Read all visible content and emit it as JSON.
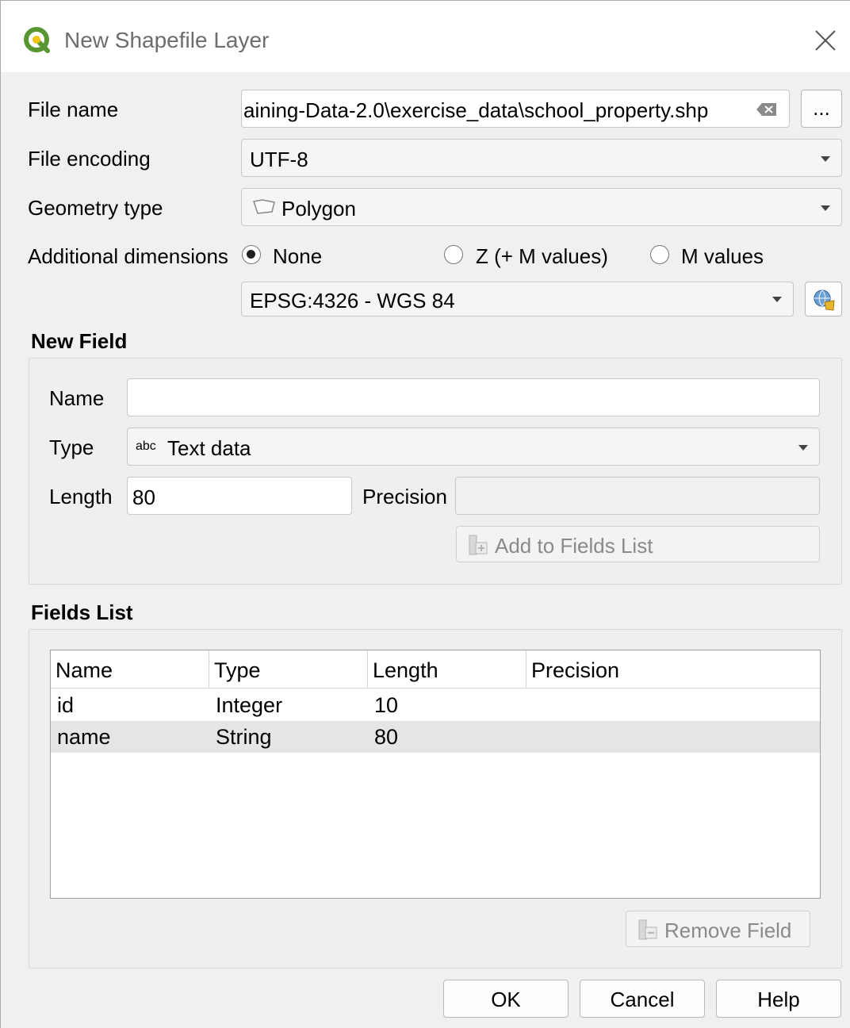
{
  "window": {
    "title": "New Shapefile Layer"
  },
  "form": {
    "file_name_label": "File name",
    "file_name_value": "aining-Data-2.0\\exercise_data\\school_property.shp",
    "browse_label": "...",
    "file_encoding_label": "File encoding",
    "file_encoding_value": "UTF-8",
    "geometry_type_label": "Geometry type",
    "geometry_type_value": "Polygon",
    "additional_dimensions_label": "Additional dimensions",
    "dimension_options": [
      "None",
      "Z (+ M values)",
      "M values"
    ],
    "dimension_selected": "None",
    "crs_value": "EPSG:4326 - WGS 84"
  },
  "new_field": {
    "title": "New Field",
    "name_label": "Name",
    "name_value": "",
    "type_label": "Type",
    "type_icon_text": "abc",
    "type_value": "Text data",
    "length_label": "Length",
    "length_value": "80",
    "precision_label": "Precision",
    "precision_value": "",
    "add_button": "Add to Fields List"
  },
  "fields_list": {
    "title": "Fields List",
    "columns": [
      "Name",
      "Type",
      "Length",
      "Precision"
    ],
    "rows": [
      {
        "name": "id",
        "type": "Integer",
        "length": "10",
        "precision": ""
      },
      {
        "name": "name",
        "type": "String",
        "length": "80",
        "precision": ""
      }
    ],
    "selected_row": 1,
    "remove_button": "Remove Field"
  },
  "buttons": {
    "ok": "OK",
    "cancel": "Cancel",
    "help": "Help"
  }
}
